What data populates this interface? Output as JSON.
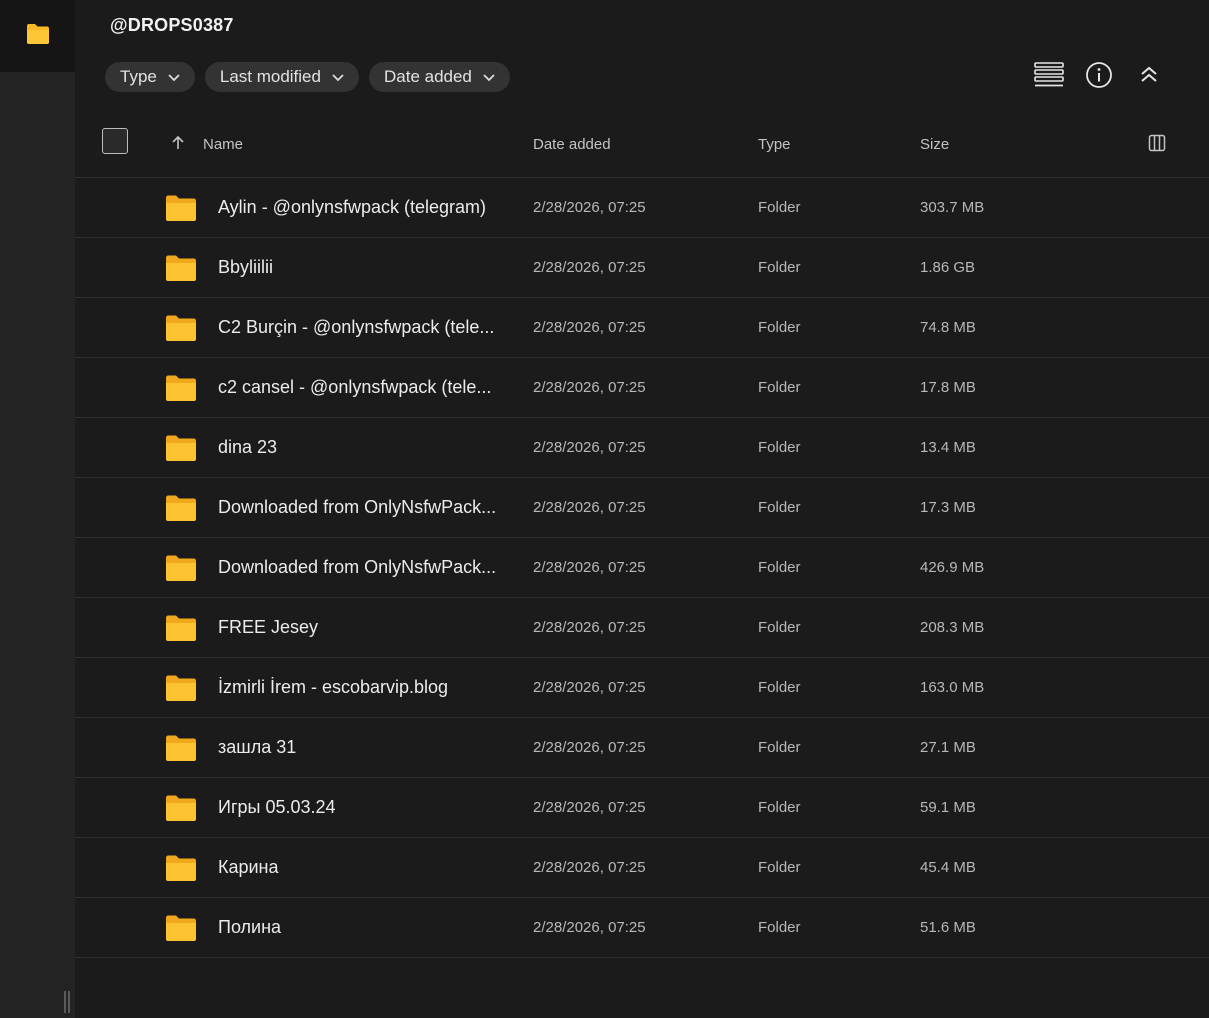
{
  "folder_title": "@DROPS0387",
  "filters": [
    {
      "label": "Type"
    },
    {
      "label": "Last modified"
    },
    {
      "label": "Date added"
    }
  ],
  "columns": {
    "name": "Name",
    "date_added": "Date added",
    "type": "Type",
    "size": "Size"
  },
  "icons": {
    "rail": "folder-icon",
    "toolbar": [
      "list-view-icon",
      "info-icon",
      "collapse-icon"
    ],
    "sort": "sort-ascending-icon",
    "columns": "column-settings-icon"
  },
  "colors": {
    "accent_folder": "#f7b924",
    "background": "#1b1b1b"
  },
  "rows": [
    {
      "name": "Aylin - @onlynsfwpack (telegram)",
      "date": "2/28/2026, 07:25",
      "type": "Folder",
      "size": "303.7 MB"
    },
    {
      "name": "Bbyliilii",
      "date": "2/28/2026, 07:25",
      "type": "Folder",
      "size": "1.86 GB"
    },
    {
      "name": "C2 Burçin - @onlynsfwpack (tele...",
      "date": "2/28/2026, 07:25",
      "type": "Folder",
      "size": "74.8 MB"
    },
    {
      "name": "c2 cansel - @onlynsfwpack (tele...",
      "date": "2/28/2026, 07:25",
      "type": "Folder",
      "size": "17.8 MB"
    },
    {
      "name": "dina 23",
      "date": "2/28/2026, 07:25",
      "type": "Folder",
      "size": "13.4 MB"
    },
    {
      "name": "Downloaded from OnlyNsfwPack...",
      "date": "2/28/2026, 07:25",
      "type": "Folder",
      "size": "17.3 MB"
    },
    {
      "name": "Downloaded from OnlyNsfwPack...",
      "date": "2/28/2026, 07:25",
      "type": "Folder",
      "size": "426.9 MB"
    },
    {
      "name": "FREE Jesey",
      "date": "2/28/2026, 07:25",
      "type": "Folder",
      "size": "208.3 MB"
    },
    {
      "name": "İzmirli İrem - escobarvip.blog",
      "date": "2/28/2026, 07:25",
      "type": "Folder",
      "size": "163.0 MB"
    },
    {
      "name": "зашла 31",
      "date": "2/28/2026, 07:25",
      "type": "Folder",
      "size": "27.1 MB"
    },
    {
      "name": "Игры 05.03.24",
      "date": "2/28/2026, 07:25",
      "type": "Folder",
      "size": "59.1 MB"
    },
    {
      "name": "Карина",
      "date": "2/28/2026, 07:25",
      "type": "Folder",
      "size": "45.4 MB"
    },
    {
      "name": "Полина",
      "date": "2/28/2026, 07:25",
      "type": "Folder",
      "size": "51.6 MB"
    }
  ]
}
